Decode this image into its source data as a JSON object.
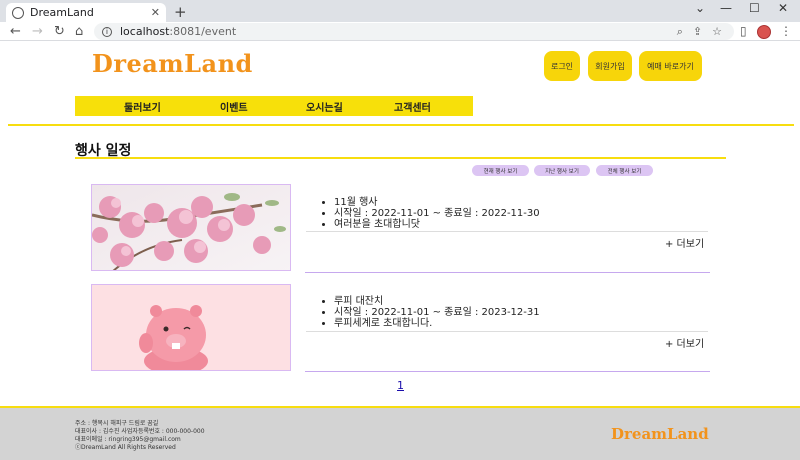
{
  "browser": {
    "tab_title": "DreamLand",
    "url_host": "localhost",
    "url_path": ":8081/event"
  },
  "header": {
    "logo": "DreamLand",
    "login": "로그인",
    "signup": "회원가입",
    "reserve": "예매 바로가기"
  },
  "menu": {
    "items": [
      "둘러보기",
      "이벤트",
      "오시는길",
      "고객센터"
    ]
  },
  "main": {
    "title": "행사 일정",
    "filters": [
      "현재 행사 보기",
      "지난 행사 보기",
      "전체 행사 보기"
    ],
    "events": [
      {
        "name": "11월 행사",
        "period": "시작일 : 2022-11-01 ~ 종료일 : 2022-11-30",
        "desc": "여러분을 초대합니닷",
        "more": "+ 더보기"
      },
      {
        "name": "루피 대잔치",
        "period": "시작일 : 2022-11-01 ~ 종료일 : 2023-12-31",
        "desc": "루피세계로 초대합니다.",
        "more": "+ 더보기"
      }
    ],
    "page": "1"
  },
  "footer": {
    "address": "주소 : 행복시 해피구 드림로 꿈길",
    "ceo": "대표이사 : 김수진 사업자등록번호 : 000-000-000",
    "email": "대표이메일 : ringring395@gmail.com",
    "copyright": "ⓒDreamLand All Rights Reserved",
    "logo": "DreamLand"
  },
  "colors": {
    "accent_yellow": "#f7d50a",
    "logo_orange": "#f2931c",
    "pill_lavender": "#dcc5f3"
  }
}
